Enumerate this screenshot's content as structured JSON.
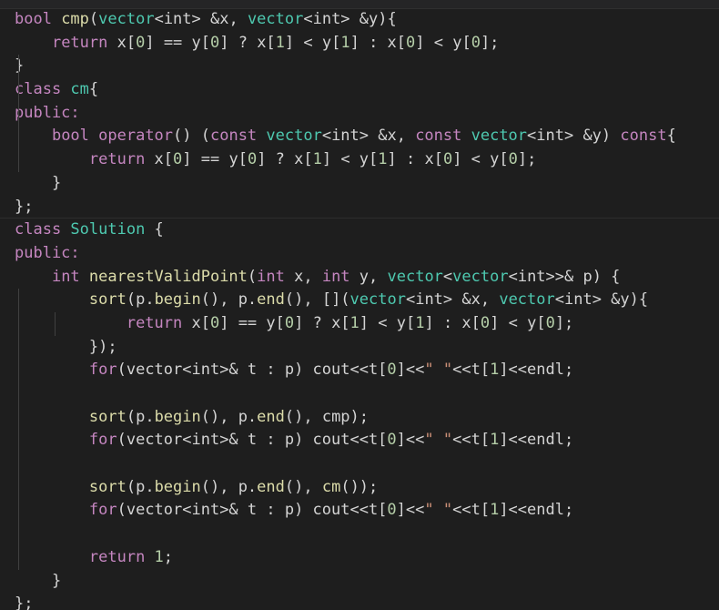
{
  "editor": {
    "language": "cpp",
    "lines": [
      [
        [
          "bool ",
          "k"
        ],
        [
          "cmp",
          "f"
        ],
        [
          "(",
          ""
        ],
        [
          "vector",
          "t"
        ],
        [
          "<int> &x, ",
          ""
        ],
        [
          "vector",
          "t"
        ],
        [
          "<int> &y){",
          ""
        ]
      ],
      [
        [
          "    ",
          ""
        ],
        [
          "return ",
          "k"
        ],
        [
          "x[",
          ""
        ],
        [
          "0",
          "n"
        ],
        [
          "] == y[",
          ""
        ],
        [
          "0",
          "n"
        ],
        [
          "] ? x[",
          ""
        ],
        [
          "1",
          "n"
        ],
        [
          "] < y[",
          ""
        ],
        [
          "1",
          "n"
        ],
        [
          "] : x[",
          ""
        ],
        [
          "0",
          "n"
        ],
        [
          "] < y[",
          ""
        ],
        [
          "0",
          "n"
        ],
        [
          "];",
          ""
        ]
      ],
      [
        [
          "}",
          ""
        ]
      ],
      [
        [
          "class ",
          "k"
        ],
        [
          "cm",
          "t"
        ],
        [
          "{",
          ""
        ]
      ],
      [
        [
          "public:",
          "k"
        ]
      ],
      [
        [
          "    ",
          ""
        ],
        [
          "bool ",
          "k"
        ],
        [
          "operator",
          "k"
        ],
        [
          "() (",
          ""
        ],
        [
          "const ",
          "k"
        ],
        [
          "vector",
          "t"
        ],
        [
          "<int> &x, ",
          ""
        ],
        [
          "const ",
          "k"
        ],
        [
          "vector",
          "t"
        ],
        [
          "<int> &y) ",
          ""
        ],
        [
          "const",
          "k"
        ],
        [
          "{",
          ""
        ]
      ],
      [
        [
          "        ",
          ""
        ],
        [
          "return ",
          "k"
        ],
        [
          "x[",
          ""
        ],
        [
          "0",
          "n"
        ],
        [
          "] == y[",
          ""
        ],
        [
          "0",
          "n"
        ],
        [
          "] ? x[",
          ""
        ],
        [
          "1",
          "n"
        ],
        [
          "] < y[",
          ""
        ],
        [
          "1",
          "n"
        ],
        [
          "] : x[",
          ""
        ],
        [
          "0",
          "n"
        ],
        [
          "] < y[",
          ""
        ],
        [
          "0",
          "n"
        ],
        [
          "];",
          ""
        ]
      ],
      [
        [
          "    }",
          ""
        ]
      ],
      [
        [
          "};",
          ""
        ]
      ],
      [
        [
          "class ",
          "k"
        ],
        [
          "Solution",
          "t"
        ],
        [
          " {",
          ""
        ]
      ],
      [
        [
          "public:",
          "k"
        ]
      ],
      [
        [
          "    ",
          ""
        ],
        [
          "int ",
          "k"
        ],
        [
          "nearestValidPoint",
          "f"
        ],
        [
          "(",
          ""
        ],
        [
          "int ",
          "k"
        ],
        [
          "x, ",
          ""
        ],
        [
          "int ",
          "k"
        ],
        [
          "y, ",
          ""
        ],
        [
          "vector",
          "t"
        ],
        [
          "<",
          ""
        ],
        [
          "vector",
          "t"
        ],
        [
          "<int>>& p) {",
          ""
        ]
      ],
      [
        [
          "        ",
          ""
        ],
        [
          "sort",
          "f"
        ],
        [
          "(p.",
          ""
        ],
        [
          "begin",
          "f"
        ],
        [
          "(), p.",
          ""
        ],
        [
          "end",
          "f"
        ],
        [
          "(), [](",
          ""
        ],
        [
          "vector",
          "t"
        ],
        [
          "<int> &x, ",
          ""
        ],
        [
          "vector",
          "t"
        ],
        [
          "<int> &y){",
          ""
        ]
      ],
      [
        [
          "            ",
          ""
        ],
        [
          "return ",
          "k"
        ],
        [
          "x[",
          ""
        ],
        [
          "0",
          "n"
        ],
        [
          "] == y[",
          ""
        ],
        [
          "0",
          "n"
        ],
        [
          "] ? x[",
          ""
        ],
        [
          "1",
          "n"
        ],
        [
          "] < y[",
          ""
        ],
        [
          "1",
          "n"
        ],
        [
          "] : x[",
          ""
        ],
        [
          "0",
          "n"
        ],
        [
          "] < y[",
          ""
        ],
        [
          "0",
          "n"
        ],
        [
          "];",
          ""
        ]
      ],
      [
        [
          "        });",
          ""
        ]
      ],
      [
        [
          "        ",
          ""
        ],
        [
          "for",
          "k"
        ],
        [
          "(vector<int>& t : p) cout<<t[",
          ""
        ],
        [
          "0",
          "n"
        ],
        [
          "]<<",
          ""
        ],
        [
          "\" \"",
          "s"
        ],
        [
          "<<t[",
          ""
        ],
        [
          "1",
          "n"
        ],
        [
          "]<<endl;",
          ""
        ]
      ],
      [
        [
          "",
          ""
        ]
      ],
      [
        [
          "        ",
          ""
        ],
        [
          "sort",
          "f"
        ],
        [
          "(p.",
          ""
        ],
        [
          "begin",
          "f"
        ],
        [
          "(), p.",
          ""
        ],
        [
          "end",
          "f"
        ],
        [
          "(), cmp);",
          ""
        ]
      ],
      [
        [
          "        ",
          ""
        ],
        [
          "for",
          "k"
        ],
        [
          "(vector<int>& t : p) cout<<t[",
          ""
        ],
        [
          "0",
          "n"
        ],
        [
          "]<<",
          ""
        ],
        [
          "\" \"",
          "s"
        ],
        [
          "<<t[",
          ""
        ],
        [
          "1",
          "n"
        ],
        [
          "]<<endl;",
          ""
        ]
      ],
      [
        [
          "",
          ""
        ]
      ],
      [
        [
          "        ",
          ""
        ],
        [
          "sort",
          "f"
        ],
        [
          "(p.",
          ""
        ],
        [
          "begin",
          "f"
        ],
        [
          "(), p.",
          ""
        ],
        [
          "end",
          "f"
        ],
        [
          "(), ",
          ""
        ],
        [
          "cm",
          "f"
        ],
        [
          "());",
          ""
        ]
      ],
      [
        [
          "        ",
          ""
        ],
        [
          "for",
          "k"
        ],
        [
          "(vector<int>& t : p) cout<<t[",
          ""
        ],
        [
          "0",
          "n"
        ],
        [
          "]<<",
          ""
        ],
        [
          "\" \"",
          "s"
        ],
        [
          "<<t[",
          ""
        ],
        [
          "1",
          "n"
        ],
        [
          "]<<endl;",
          ""
        ]
      ],
      [
        [
          "",
          ""
        ]
      ],
      [
        [
          "        ",
          ""
        ],
        [
          "return ",
          "k"
        ],
        [
          "1",
          "n"
        ],
        [
          ";",
          ""
        ]
      ],
      [
        [
          "    }",
          ""
        ]
      ],
      [
        [
          "};",
          ""
        ]
      ]
    ]
  },
  "colors": {
    "background": "#1e1e1e",
    "keyword": "#c586c0",
    "function": "#dcdcaa",
    "type": "#4ec9b0",
    "number": "#b5cea8",
    "string": "#ce9178",
    "default": "#d4d4d4"
  }
}
